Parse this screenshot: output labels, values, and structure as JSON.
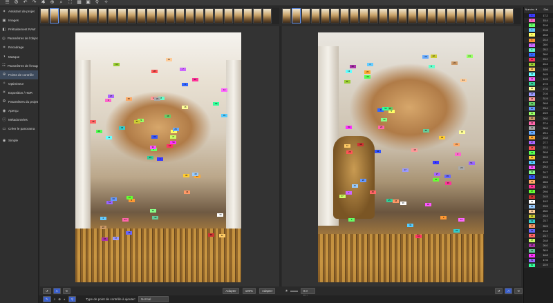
{
  "toolbar": {
    "icons": [
      "menu-icon",
      "gear-icon",
      "undo-icon",
      "redo-icon",
      "settings-icon",
      "zoom-icon",
      "search-icon",
      "fit-icon",
      "grid-icon",
      "image-icon",
      "pin-icon",
      "lightbulb-icon"
    ]
  },
  "sidebar": {
    "items": [
      {
        "label": "Assistant de projet",
        "icon": "wand-icon"
      },
      {
        "label": "Images",
        "icon": "image-icon"
      },
      {
        "label": "Prétraitement RAW",
        "icon": "raw-icon"
      },
      {
        "label": "Paramètres de l'objectif",
        "icon": "lens-icon"
      },
      {
        "label": "Recadrage",
        "icon": "crop-icon"
      },
      {
        "label": "Masque",
        "icon": "mask-icon"
      },
      {
        "label": "Paramètres de l'image",
        "icon": "sliders-icon"
      },
      {
        "label": "Points de contrôle",
        "icon": "target-icon"
      },
      {
        "label": "Optimiseur",
        "icon": "optimizer-icon"
      },
      {
        "label": "Exposition / HDR",
        "icon": "sun-icon"
      },
      {
        "label": "Paramètres du projet",
        "icon": "gear-icon"
      },
      {
        "label": "Aperçu",
        "icon": "eye-icon"
      },
      {
        "label": "Métadonnées",
        "icon": "info-icon"
      },
      {
        "label": "Créer le panorama",
        "icon": "pano-icon"
      }
    ],
    "mode_label": "Simple"
  },
  "bottom": {
    "adapt_left": "Adapter",
    "zoom": "100%",
    "adapt_right": "Adapter",
    "ev": "0.0 EV"
  },
  "footer": {
    "label": "Type de point de contrôle à ajouter:",
    "type": "Normal"
  },
  "cp_table": {
    "col1": "Numéro ▼",
    "col2": "Dist.",
    "rows": [
      {
        "n": "1",
        "d": "17.2",
        "c": "#3a3aff"
      },
      {
        "n": "2",
        "d": "15.4",
        "c": "#ff66cc"
      },
      {
        "n": "3",
        "d": "21.6",
        "c": "#66ff66"
      },
      {
        "n": "4",
        "d": "21.6",
        "c": "#66ccff"
      },
      {
        "n": "5",
        "d": "20.8",
        "c": "#ffff66"
      },
      {
        "n": "6",
        "d": "24.4",
        "c": "#ff9933"
      },
      {
        "n": "7",
        "d": "28.0",
        "c": "#cc66ff"
      },
      {
        "n": "8",
        "d": "25.2",
        "c": "#66ffcc"
      },
      {
        "n": "9",
        "d": "39.0",
        "c": "#3366ff"
      },
      {
        "n": "10",
        "d": "23.2",
        "c": "#ff3366"
      },
      {
        "n": "11",
        "d": "24.4",
        "c": "#99cc33"
      },
      {
        "n": "12",
        "d": "18.6",
        "c": "#ffcc66"
      },
      {
        "n": "13",
        "d": "24.5",
        "c": "#66ffff"
      },
      {
        "n": "14",
        "d": "14.5",
        "c": "#ff66ff"
      },
      {
        "n": "15",
        "d": "27.9",
        "c": "#33cc99"
      },
      {
        "n": "16",
        "d": "27.6",
        "c": "#ffff99"
      },
      {
        "n": "17",
        "d": "21.6",
        "c": "#9999ff"
      },
      {
        "n": "18",
        "d": "31.9",
        "c": "#ff9999"
      },
      {
        "n": "19",
        "d": "26.8",
        "c": "#66cc66"
      },
      {
        "n": "20",
        "d": "23.4",
        "c": "#6699ff"
      },
      {
        "n": "21",
        "d": "23.9",
        "c": "#99ff66"
      },
      {
        "n": "22",
        "d": "26.0",
        "c": "#cc9966"
      },
      {
        "n": "23",
        "d": "27.4",
        "c": "#ff66aa"
      },
      {
        "n": "24",
        "d": "30.6",
        "c": "#aaaaaa"
      },
      {
        "n": "25",
        "d": "29.1",
        "c": "#66aaff"
      },
      {
        "n": "26",
        "d": "24.8",
        "c": "#ffaa33"
      },
      {
        "n": "27",
        "d": "27.7",
        "c": "#aa66ff"
      },
      {
        "n": "28",
        "d": "22.1",
        "c": "#ff5555"
      },
      {
        "n": "29",
        "d": "20.8",
        "c": "#55ff55"
      },
      {
        "n": "30",
        "d": "22.9",
        "c": "#ffcc33"
      },
      {
        "n": "31",
        "d": "21.9",
        "c": "#55ccff"
      },
      {
        "n": "32",
        "d": "29.4",
        "c": "#ff55ff"
      },
      {
        "n": "33",
        "d": "24.7",
        "c": "#88ff88"
      },
      {
        "n": "34",
        "d": "23.3",
        "c": "#3355ff"
      },
      {
        "n": "35",
        "d": "28.6",
        "c": "#ffaa66"
      },
      {
        "n": "36",
        "d": "25.7",
        "c": "#ff3399"
      },
      {
        "n": "37",
        "d": "29.6",
        "c": "#66ff33"
      },
      {
        "n": "38",
        "d": "24.5",
        "c": "#cc3333"
      },
      {
        "n": "39",
        "d": "19.2",
        "c": "#ffffff"
      },
      {
        "n": "40",
        "d": "23.5",
        "c": "#99ccff"
      },
      {
        "n": "41",
        "d": "26.0",
        "c": "#ffcc99"
      },
      {
        "n": "42",
        "d": "24.3",
        "c": "#cccc33"
      },
      {
        "n": "43",
        "d": "23.7",
        "c": "#33cccc"
      },
      {
        "n": "44",
        "d": "26.5",
        "c": "#ff9966"
      },
      {
        "n": "45",
        "d": "21.3",
        "c": "#6666ff"
      },
      {
        "n": "46",
        "d": "23.7",
        "c": "#ff6666"
      },
      {
        "n": "47",
        "d": "24.8",
        "c": "#ccff66"
      },
      {
        "n": "48",
        "d": "26.0",
        "c": "#aa33aa"
      },
      {
        "n": "49",
        "d": "30.9",
        "c": "#66cc99"
      },
      {
        "n": "50",
        "d": "16.8",
        "c": "#ff33ff"
      },
      {
        "n": "51",
        "d": "17.6",
        "c": "#9966ff"
      },
      {
        "n": "52",
        "d": "22.9",
        "c": "#33ff99"
      }
    ]
  }
}
